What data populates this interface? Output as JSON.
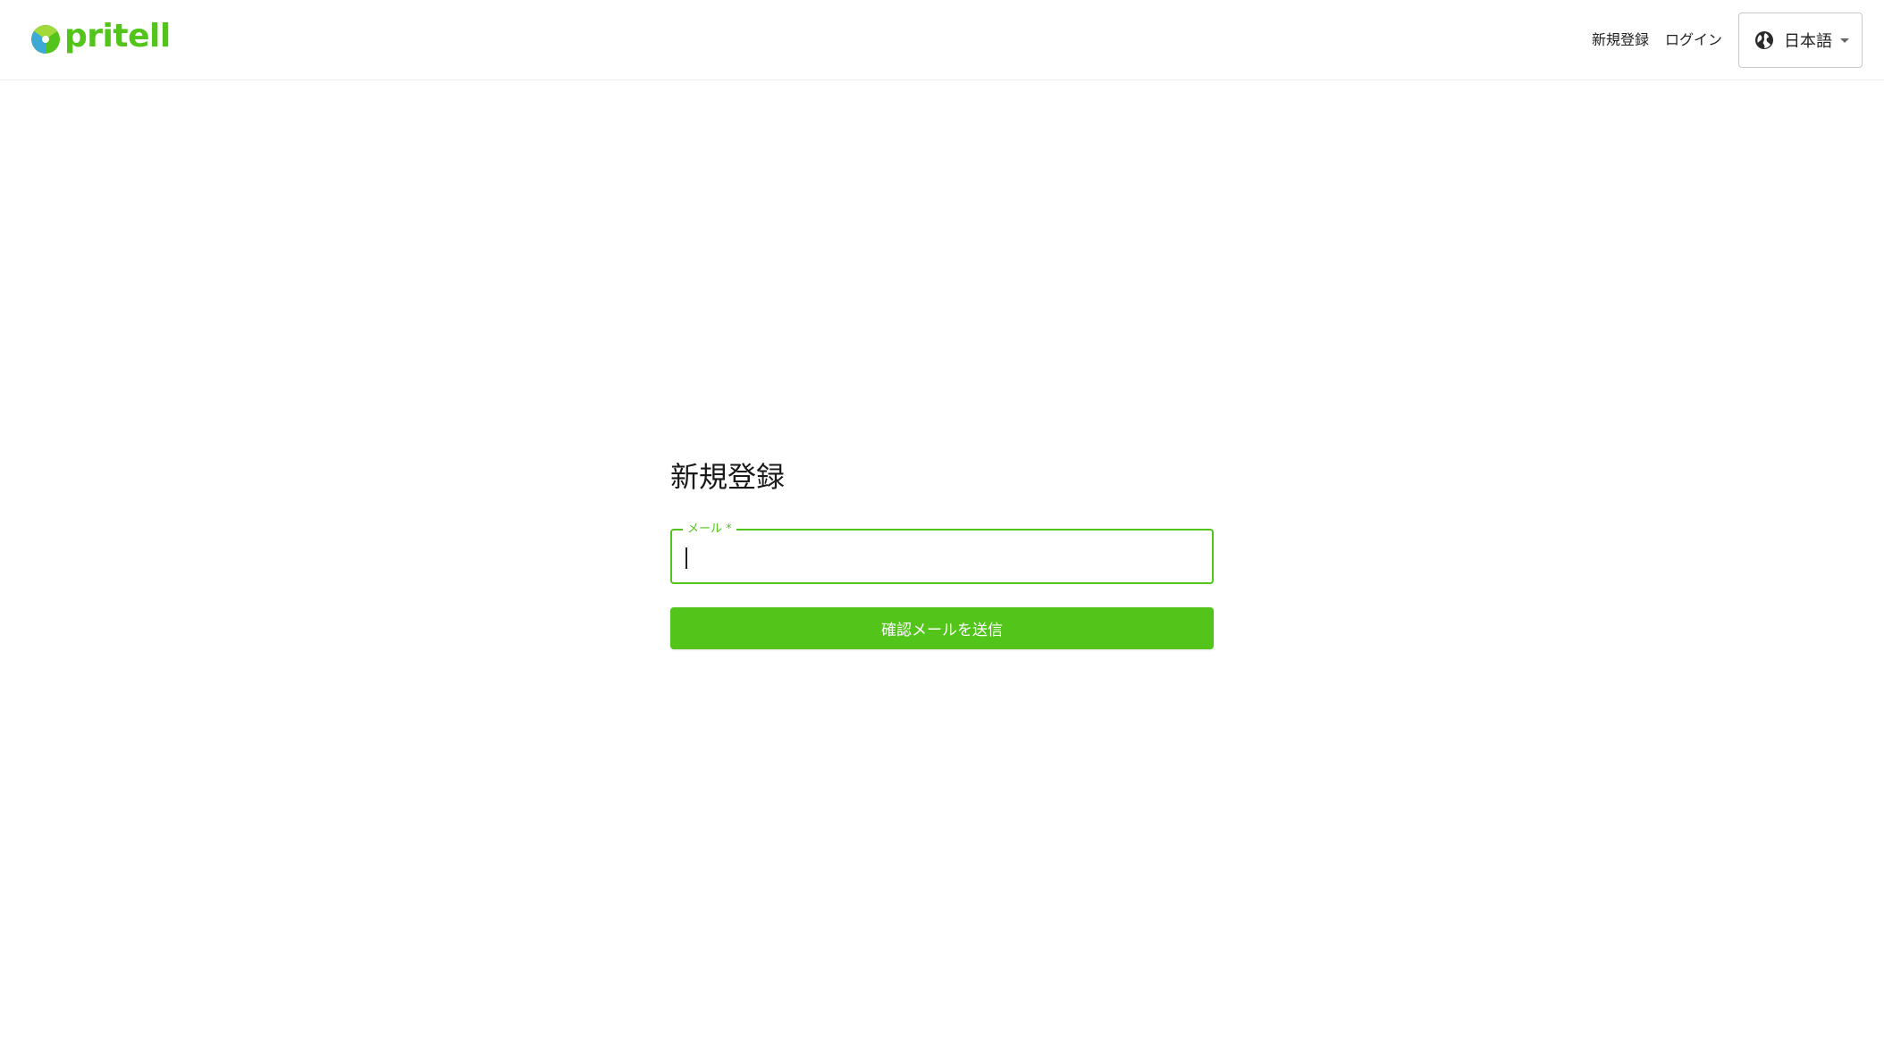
{
  "header": {
    "logo_text": "pritell",
    "nav": {
      "signup": "新規登録",
      "login": "ログイン"
    },
    "language": {
      "selected": "日本語"
    }
  },
  "form": {
    "title": "新規登録",
    "email": {
      "label": "メール *",
      "value": ""
    },
    "submit_label": "確認メールを送信"
  },
  "colors": {
    "brand_green": "#52c41a",
    "logo_blue": "#3fa9d6",
    "logo_yellow": "#f2c94c"
  },
  "icons": {
    "logo": "pritell-logo-icon",
    "language": "globe-icon",
    "dropdown": "caret-down-icon"
  }
}
